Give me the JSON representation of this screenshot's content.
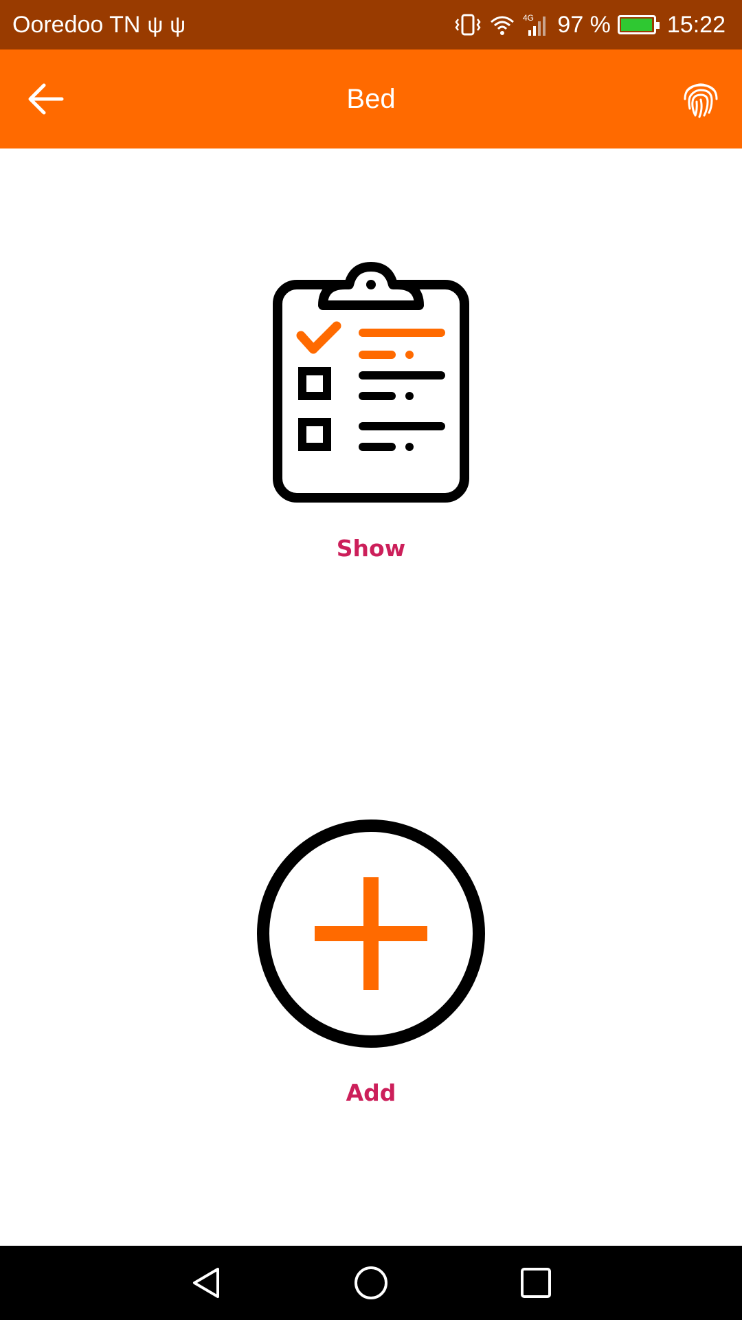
{
  "status_bar": {
    "carrier": "Ooredoo TN",
    "usb_icons": [
      "usb-icon",
      "usb-icon"
    ],
    "icons": [
      "vibrate-icon",
      "wifi-icon",
      "4g-icon",
      "signal-icon",
      "battery-icon"
    ],
    "network_type": "4G",
    "battery": "97 %",
    "battery_level": 0.97,
    "time": "15:22"
  },
  "app_bar": {
    "title": "Bed",
    "back_icon": "arrow-back-icon",
    "action_icon": "fingerprint-icon"
  },
  "actions": {
    "show": {
      "label": "Show",
      "icon": "clipboard-checklist-icon"
    },
    "add": {
      "label": "Add",
      "icon": "add-circle-icon"
    }
  },
  "nav_bar": {
    "icons": [
      "nav-back-icon",
      "nav-home-icon",
      "nav-recents-icon"
    ]
  },
  "colors": {
    "status_bar": "#993b00",
    "app_bar": "#ff6a00",
    "accent": "#ff6a00",
    "label": "#cc1f5a",
    "icon_dark": "#000000"
  }
}
